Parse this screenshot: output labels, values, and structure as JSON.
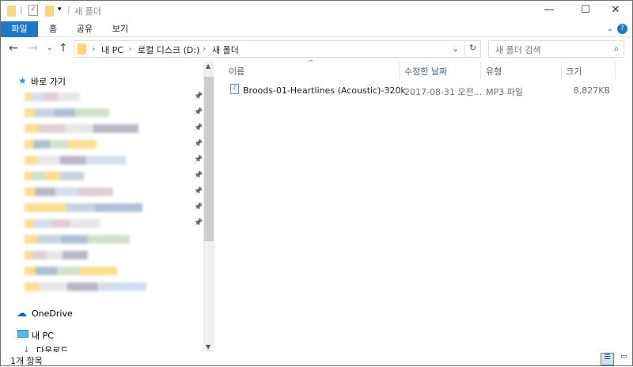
{
  "title": "새 폴더",
  "ribbon": {
    "tabs": [
      "파일",
      "홈",
      "공유",
      "보기"
    ]
  },
  "address": {
    "crumbs": [
      "내 PC",
      "로컬 디스크 (D:)",
      "새 폴더"
    ]
  },
  "search": {
    "placeholder": "새 폴더 검색"
  },
  "nav": {
    "quick_access": "바로 가기",
    "onedrive": "OneDrive",
    "this_pc": "내 PC",
    "downloads": "다운로드"
  },
  "columns": {
    "name": "이름",
    "date": "수정한 날짜",
    "type": "유형",
    "size": "크기"
  },
  "files": [
    {
      "name": "Broods-01-Heartlines (Acoustic)-320k",
      "date": "2017-08-31 오전...",
      "type": "MP3 파일",
      "size": "8,827KB"
    }
  ],
  "status": {
    "count": "1개 항목"
  },
  "colors": {
    "accent": "#1979ca",
    "folder": "#f8d775"
  }
}
